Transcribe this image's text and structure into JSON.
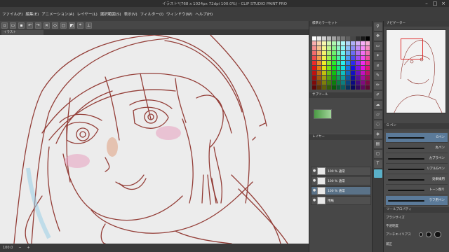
{
  "titlebar": {
    "title": "イラスト*(768 x 1024px 72dpi 100.0%) - CLIP STUDIO PAINT PRO"
  },
  "menu": [
    "ファイル(F)",
    "編集(E)",
    "アニメーション(A)",
    "レイヤー(L)",
    "選択範囲(S)",
    "表示(V)",
    "フィルター(I)",
    "ウィンドウ(W)",
    "ヘルプ(H)"
  ],
  "canvas_tab": "イラスト",
  "panels": {
    "color_set": "標準カラーセット",
    "sub_tool": "サブツール",
    "layer": "レイヤー",
    "navigator": "ナビゲーター",
    "brush_group": "G ペン",
    "tool_property": "ツールプロパティ"
  },
  "layers": [
    {
      "name": "100 % 通常",
      "sub": "レイヤー 3"
    },
    {
      "name": "100 % 通常",
      "sub": "レイヤー 2"
    },
    {
      "name": "100 % 通常",
      "sub": "レイヤー 1"
    },
    {
      "name": "用紙",
      "sub": ""
    }
  ],
  "brushes": [
    {
      "label": "Gペン"
    },
    {
      "label": "丸ペン"
    },
    {
      "label": "カブラペン"
    },
    {
      "label": "リアルGペン"
    },
    {
      "label": "効果線用"
    },
    {
      "label": "トーン削り"
    },
    {
      "label": "ラフ用ペン"
    }
  ],
  "tool_properties": {
    "brush_size_label": "ブラシサイズ",
    "opacity_label": "不透明度",
    "antialias_label": "アンチエイリアス",
    "stabilization_label": "補正"
  },
  "status": {
    "zoom": "100.0"
  },
  "colors": {
    "accent": "#5a7288",
    "sketch_line": "#8a2b24",
    "blush": "#e8a0c0",
    "selection_frame": "#e03030"
  }
}
